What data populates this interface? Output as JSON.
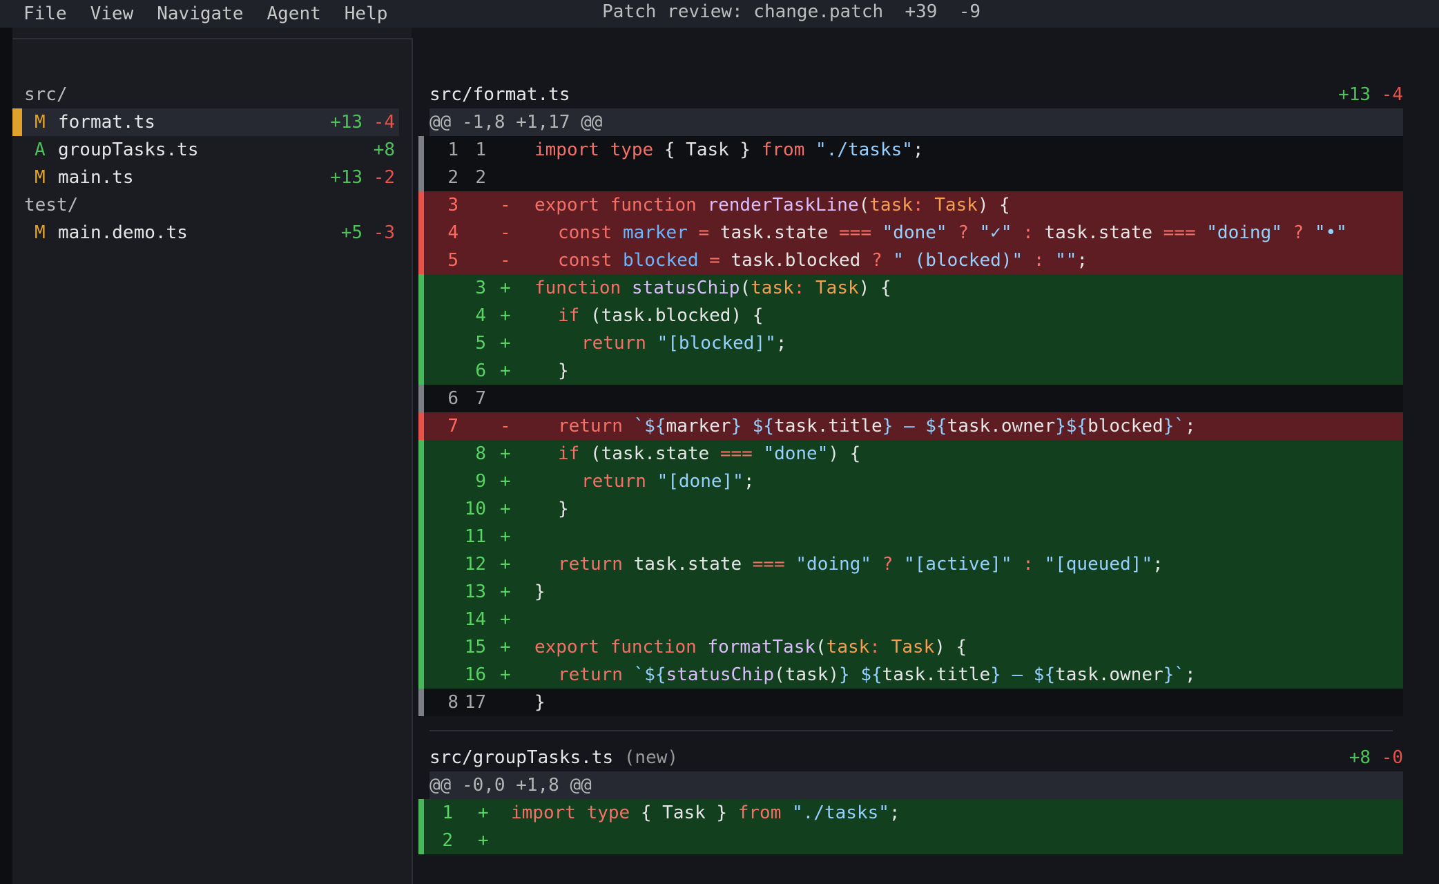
{
  "menu": [
    "File",
    "View",
    "Navigate",
    "Agent",
    "Help"
  ],
  "title": "Patch review: change.patch  +39  -9",
  "sidebar": {
    "folders": [
      "src/",
      "test/"
    ],
    "files": [
      {
        "status": "M",
        "name": "format.ts",
        "add": "+13",
        "del": "-4",
        "status_color": "#e0a22d"
      },
      {
        "status": "A",
        "name": "groupTasks.ts",
        "add": "+8",
        "del": "",
        "status_color": "#4fc05a"
      },
      {
        "status": "M",
        "name": "main.ts",
        "add": "+13",
        "del": "-2",
        "status_color": "#e0a22d"
      },
      {
        "status": "M",
        "name": "main.demo.ts",
        "add": "+5",
        "del": "-3",
        "status_color": "#e0a22d"
      }
    ]
  },
  "diff": {
    "files": [
      {
        "path": "src/format.ts",
        "note": "",
        "add": "+13",
        "del": "-4",
        "hunk": "@@ -1,8 +1,17 @@",
        "lines": [
          {
            "type": "ctx",
            "old": "1",
            "new": "1",
            "mark": "",
            "indent": 0,
            "tokens": [
              [
                "kw",
                "import"
              ],
              [
                "pl",
                " "
              ],
              [
                "kw",
                "type"
              ],
              [
                "pl",
                " { Task } "
              ],
              [
                "kw",
                "from"
              ],
              [
                "pl",
                " "
              ],
              [
                "str",
                "\"./tasks\""
              ],
              [
                "pl",
                ";"
              ]
            ]
          },
          {
            "type": "ctx",
            "old": "2",
            "new": "2",
            "mark": "",
            "indent": 0,
            "tokens": []
          },
          {
            "type": "rem",
            "old": "3",
            "new": "",
            "mark": "-",
            "indent": 0,
            "tokens": [
              [
                "kw",
                "export"
              ],
              [
                "pl",
                " "
              ],
              [
                "kw",
                "function"
              ],
              [
                "pl",
                " "
              ],
              [
                "fn",
                "renderTaskLine"
              ],
              [
                "pl",
                "("
              ],
              [
                "ty",
                "task"
              ],
              [
                "kw",
                ":"
              ],
              [
                "pl",
                " "
              ],
              [
                "ty",
                "Task"
              ],
              [
                "pl",
                ") {"
              ]
            ]
          },
          {
            "type": "rem",
            "old": "4",
            "new": "",
            "mark": "-",
            "indent": 1,
            "tokens": [
              [
                "kw",
                "const"
              ],
              [
                "pl",
                " "
              ],
              [
                "var",
                "marker"
              ],
              [
                "pl",
                " "
              ],
              [
                "op",
                "="
              ],
              [
                "pl",
                " task.state "
              ],
              [
                "op",
                "==="
              ],
              [
                "pl",
                " "
              ],
              [
                "str",
                "\"done\""
              ],
              [
                "pl",
                " "
              ],
              [
                "op",
                "?"
              ],
              [
                "pl",
                " "
              ],
              [
                "str",
                "\"✓\""
              ],
              [
                "pl",
                " "
              ],
              [
                "op",
                ":"
              ],
              [
                "pl",
                " task.state "
              ],
              [
                "op",
                "==="
              ],
              [
                "pl",
                " "
              ],
              [
                "str",
                "\"doing\""
              ],
              [
                "pl",
                " "
              ],
              [
                "op",
                "?"
              ],
              [
                "pl",
                " "
              ],
              [
                "str",
                "\"•\""
              ]
            ]
          },
          {
            "type": "rem",
            "old": "5",
            "new": "",
            "mark": "-",
            "indent": 1,
            "tokens": [
              [
                "kw",
                "const"
              ],
              [
                "pl",
                " "
              ],
              [
                "var",
                "blocked"
              ],
              [
                "pl",
                " "
              ],
              [
                "op",
                "="
              ],
              [
                "pl",
                " task.blocked "
              ],
              [
                "op",
                "?"
              ],
              [
                "pl",
                " "
              ],
              [
                "str",
                "\" (blocked)\""
              ],
              [
                "pl",
                " "
              ],
              [
                "op",
                ":"
              ],
              [
                "pl",
                " "
              ],
              [
                "str",
                "\"\""
              ],
              [
                "pl",
                ";"
              ]
            ]
          },
          {
            "type": "addl",
            "old": "",
            "new": "3",
            "mark": "+",
            "indent": 0,
            "tokens": [
              [
                "kw",
                "function"
              ],
              [
                "pl",
                " "
              ],
              [
                "fn",
                "statusChip"
              ],
              [
                "pl",
                "("
              ],
              [
                "ty",
                "task"
              ],
              [
                "kw",
                ":"
              ],
              [
                "pl",
                " "
              ],
              [
                "ty",
                "Task"
              ],
              [
                "pl",
                ") {"
              ]
            ]
          },
          {
            "type": "addl",
            "old": "",
            "new": "4",
            "mark": "+",
            "indent": 1,
            "tokens": [
              [
                "kw",
                "if"
              ],
              [
                "pl",
                " (task.blocked) {"
              ]
            ]
          },
          {
            "type": "addl",
            "old": "",
            "new": "5",
            "mark": "+",
            "indent": 2,
            "tokens": [
              [
                "kw",
                "return"
              ],
              [
                "pl",
                " "
              ],
              [
                "str",
                "\"[blocked]\""
              ],
              [
                "pl",
                ";"
              ]
            ]
          },
          {
            "type": "addl",
            "old": "",
            "new": "6",
            "mark": "+",
            "indent": 1,
            "tokens": [
              [
                "pl",
                "}"
              ]
            ]
          },
          {
            "type": "ctx",
            "old": "6",
            "new": "7",
            "mark": "",
            "indent": 0,
            "tokens": []
          },
          {
            "type": "rem",
            "old": "7",
            "new": "",
            "mark": "-",
            "indent": 1,
            "tokens": [
              [
                "kw",
                "return"
              ],
              [
                "pl",
                " "
              ],
              [
                "str",
                "`${"
              ],
              [
                "pl",
                "marker"
              ],
              [
                "str",
                "} ${"
              ],
              [
                "pl",
                "task.title"
              ],
              [
                "str",
                "} — ${"
              ],
              [
                "pl",
                "task.owner"
              ],
              [
                "str",
                "}${"
              ],
              [
                "pl",
                "blocked"
              ],
              [
                "str",
                "}`"
              ],
              [
                "pl",
                ";"
              ]
            ]
          },
          {
            "type": "addl",
            "old": "",
            "new": "8",
            "mark": "+",
            "indent": 1,
            "tokens": [
              [
                "kw",
                "if"
              ],
              [
                "pl",
                " (task.state "
              ],
              [
                "op",
                "==="
              ],
              [
                "pl",
                " "
              ],
              [
                "str",
                "\"done\""
              ],
              [
                "pl",
                ") {"
              ]
            ]
          },
          {
            "type": "addl",
            "old": "",
            "new": "9",
            "mark": "+",
            "indent": 2,
            "tokens": [
              [
                "kw",
                "return"
              ],
              [
                "pl",
                " "
              ],
              [
                "str",
                "\"[done]\""
              ],
              [
                "pl",
                ";"
              ]
            ]
          },
          {
            "type": "addl",
            "old": "",
            "new": "10",
            "mark": "+",
            "indent": 1,
            "tokens": [
              [
                "pl",
                "}"
              ]
            ]
          },
          {
            "type": "addl",
            "old": "",
            "new": "11",
            "mark": "+",
            "indent": 0,
            "tokens": []
          },
          {
            "type": "addl",
            "old": "",
            "new": "12",
            "mark": "+",
            "indent": 1,
            "tokens": [
              [
                "kw",
                "return"
              ],
              [
                "pl",
                " task.state "
              ],
              [
                "op",
                "==="
              ],
              [
                "pl",
                " "
              ],
              [
                "str",
                "\"doing\""
              ],
              [
                "pl",
                " "
              ],
              [
                "op",
                "?"
              ],
              [
                "pl",
                " "
              ],
              [
                "str",
                "\"[active]\""
              ],
              [
                "pl",
                " "
              ],
              [
                "op",
                ":"
              ],
              [
                "pl",
                " "
              ],
              [
                "str",
                "\"[queued]\""
              ],
              [
                "pl",
                ";"
              ]
            ]
          },
          {
            "type": "addl",
            "old": "",
            "new": "13",
            "mark": "+",
            "indent": 0,
            "tokens": [
              [
                "pl",
                "}"
              ]
            ]
          },
          {
            "type": "addl",
            "old": "",
            "new": "14",
            "mark": "+",
            "indent": 0,
            "tokens": []
          },
          {
            "type": "addl",
            "old": "",
            "new": "15",
            "mark": "+",
            "indent": 0,
            "tokens": [
              [
                "kw",
                "export"
              ],
              [
                "pl",
                " "
              ],
              [
                "kw",
                "function"
              ],
              [
                "pl",
                " "
              ],
              [
                "fn",
                "formatTask"
              ],
              [
                "pl",
                "("
              ],
              [
                "ty",
                "task"
              ],
              [
                "kw",
                ":"
              ],
              [
                "pl",
                " "
              ],
              [
                "ty",
                "Task"
              ],
              [
                "pl",
                ") {"
              ]
            ]
          },
          {
            "type": "addl",
            "old": "",
            "new": "16",
            "mark": "+",
            "indent": 1,
            "tokens": [
              [
                "kw",
                "return"
              ],
              [
                "pl",
                " "
              ],
              [
                "str",
                "`${"
              ],
              [
                "fn",
                "statusChip"
              ],
              [
                "pl",
                "(task)"
              ],
              [
                "str",
                "} ${"
              ],
              [
                "pl",
                "task.title"
              ],
              [
                "str",
                "} — ${"
              ],
              [
                "pl",
                "task.owner"
              ],
              [
                "str",
                "}`"
              ],
              [
                "pl",
                ";"
              ]
            ]
          },
          {
            "type": "ctx",
            "old": "8",
            "new": "17",
            "mark": "",
            "indent": 0,
            "tokens": [
              [
                "pl",
                "}"
              ]
            ]
          }
        ]
      },
      {
        "path": "src/groupTasks.ts",
        "note": "(new)",
        "add": "+8",
        "del": "-0",
        "hunk": "@@ -0,0 +1,8 @@",
        "lines": [
          {
            "type": "addl",
            "old": "",
            "new": "1",
            "mark": "+",
            "indent": 0,
            "tokens": [
              [
                "kw",
                "import"
              ],
              [
                "pl",
                " "
              ],
              [
                "kw",
                "type"
              ],
              [
                "pl",
                " { Task } "
              ],
              [
                "kw",
                "from"
              ],
              [
                "pl",
                " "
              ],
              [
                "str",
                "\"./tasks\""
              ],
              [
                "pl",
                ";"
              ]
            ]
          },
          {
            "type": "addl",
            "old": "",
            "new": "2",
            "mark": "+",
            "indent": 0,
            "tokens": []
          }
        ]
      }
    ]
  }
}
